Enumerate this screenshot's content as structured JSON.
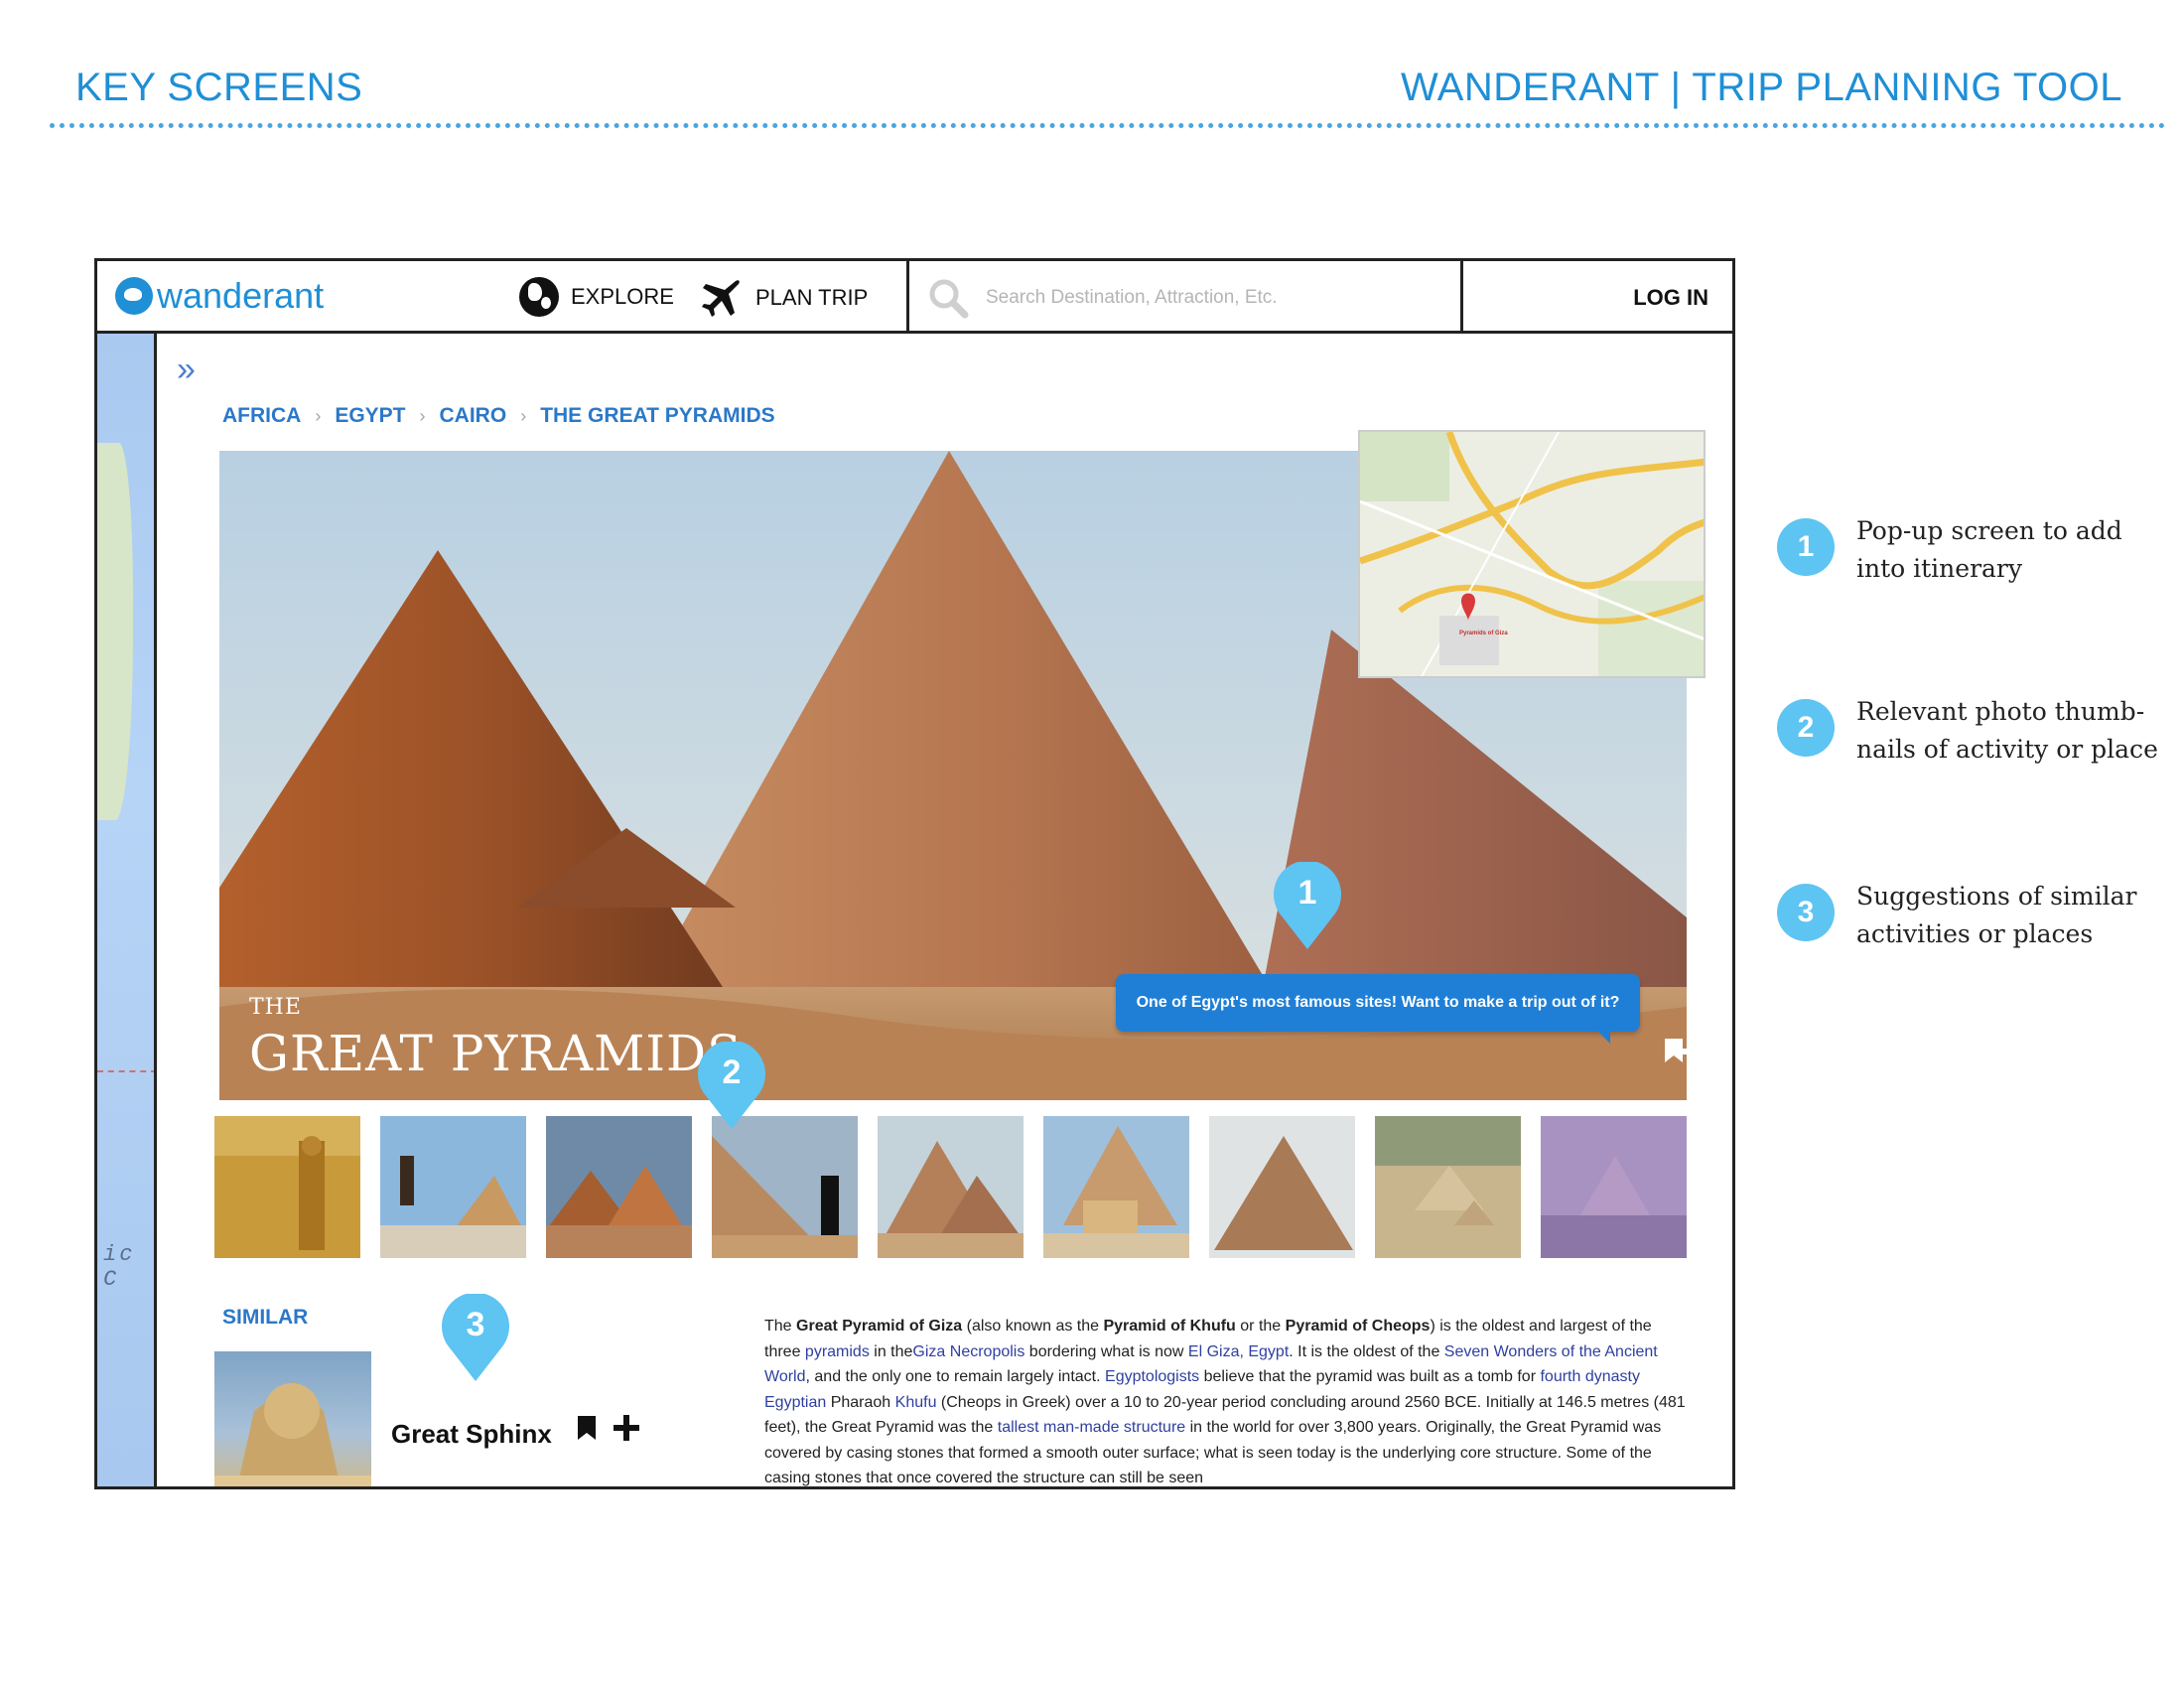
{
  "page_header": {
    "left": "KEY SCREENS",
    "right": "WANDERANT | TRIP PLANNING TOOL"
  },
  "nav": {
    "logo": "wanderant",
    "explore": "EXPLORE",
    "plan_trip": "PLAN TRIP",
    "search_placeholder": "Search Destination, Attraction, Etc.",
    "login": "LOG IN"
  },
  "sidebar": {
    "map_text": "ic C"
  },
  "breadcrumb": [
    "AFRICA",
    "EGYPT",
    "CAIRO",
    "THE GREAT PYRAMIDS"
  ],
  "hero": {
    "pretitle": "THE",
    "title": "GREAT PYRAMIDS",
    "popup": "One of Egypt's most famous sites! Want to make a trip out of it?",
    "map_pin_label": "Pyramids of Giza"
  },
  "markers": [
    "1",
    "2",
    "3"
  ],
  "similar": {
    "label": "SIMILAR",
    "item_name": "Great Sphinx"
  },
  "description": {
    "t1": "The ",
    "b1": "Great Pyramid of Giza",
    "t2": " (also known as the ",
    "b2": "Pyramid of Khufu",
    "t3": " or the ",
    "b3": "Pyramid of Cheops",
    "t4": ") is the oldest and largest of the three ",
    "l1": "pyramids",
    "t5": " in the",
    "l2": "Giza Necropolis",
    "t6": " bordering what is now ",
    "l3": "El Giza, Egypt",
    "t7": ". It is the oldest of the ",
    "l4": "Seven Wonders of the Ancient World",
    "t8": ", and the only one to remain largely intact. ",
    "l5": "Egyptologists",
    "t9": " believe that the pyramid was built as a tomb for ",
    "l6": "fourth dynasty Egyptian",
    "t10": " Pharaoh ",
    "l7": "Khufu",
    "t11": " (Cheops in Greek) over a 10 to 20-year period concluding around 2560 BCE. Initially at 146.5 metres (481 feet), the Great Pyramid was the ",
    "l8": "tallest man-made structure",
    "t12": " in the world for over 3,800 years. Originally, the Great Pyramid was covered by casing stones that formed a smooth outer surface; what is seen today is the underlying core structure. Some of the casing stones that once covered the structure can still be seen"
  },
  "annotations": [
    {
      "num": "1",
      "line1": "Pop-up screen to add",
      "line2": "into itinerary"
    },
    {
      "num": "2",
      "line1": "Relevant photo thumb-",
      "line2": "nails of activity or place"
    },
    {
      "num": "3",
      "line1": "Suggestions of similar",
      "line2": "activities or places"
    }
  ],
  "colors": {
    "brand_blue": "#1f8fd6",
    "link_blue": "#2b78c8",
    "marker_blue": "#5ec4f2",
    "popup_blue": "#1f7fd6"
  }
}
